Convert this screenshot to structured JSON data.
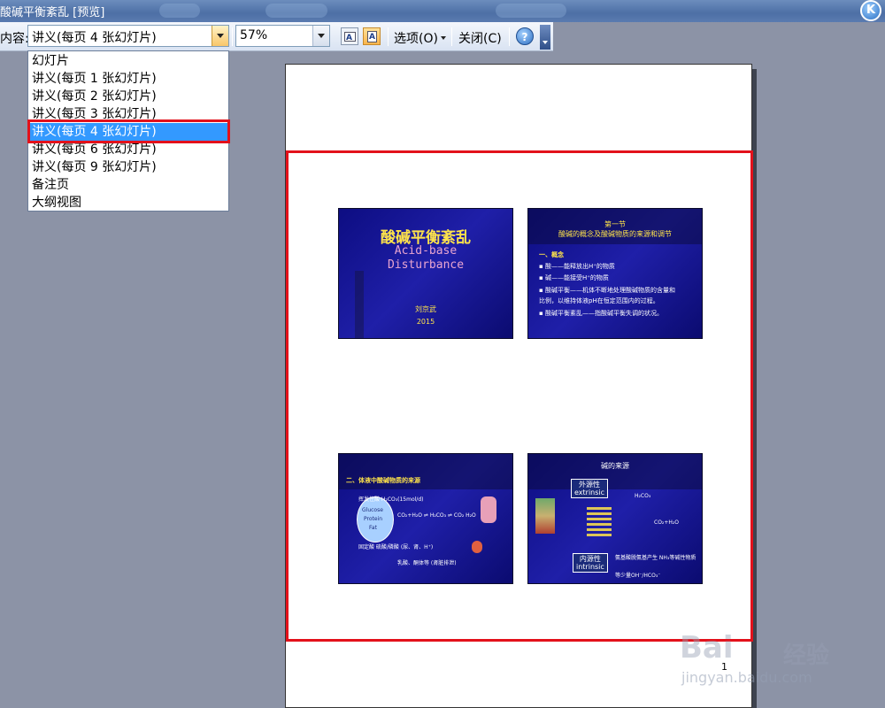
{
  "window": {
    "title": "酸碱平衡紊乱 [预览]"
  },
  "toolbar": {
    "content_label": "内容:",
    "content_value": "讲义(每页 4 张幻灯片)",
    "zoom_value": "57%",
    "options_label": "选项(O)",
    "close_label": "关闭(C)",
    "help_glyph": "?",
    "icons": [
      "landscape-orientation-icon",
      "portrait-orientation-icon",
      "help-icon"
    ]
  },
  "dropdown": {
    "items": [
      "幻灯片",
      "讲义(每页 1 张幻灯片)",
      "讲义(每页 2 张幻灯片)",
      "讲义(每页 3 张幻灯片)",
      "讲义(每页 4 张幻灯片)",
      "讲义(每页 6 张幻灯片)",
      "讲义(每页 9 张幻灯片)",
      "备注页",
      "大纲视图"
    ],
    "selected_index": 4
  },
  "preview": {
    "page_number": "1",
    "slides": {
      "s1": {
        "title_cn": "酸碱平衡紊乱",
        "title_en_1": "Acid-base",
        "title_en_2": "Disturbance",
        "author": "刘京武",
        "year": "2015"
      },
      "s2": {
        "heading1": "第一节",
        "heading2": "酸碱的概念及酸碱物质的来源和调节",
        "sub": "一、概念",
        "l1": "▪ 酸——能释放出H⁺的物质",
        "l2": "▪ 碱——能接受H⁺的物质",
        "l3": "▪ 酸碱平衡——机体不断地处理酸碱物质的含量和",
        "l4": "  比例，以维持体液pH在恒定范围内的过程。",
        "l5": "▪ 酸碱平衡紊乱——指酸碱平衡失调的状况。"
      },
      "s3": {
        "heading": "二、体液中酸碱物质的来源",
        "sugar": "Glucose",
        "protein": "Protein",
        "fat": "Fat",
        "eq1": "挥发性酸 H₂CO₃(15mol/d)",
        "eq2": "CO₂+H₂O ⇌ H₂CO₃ ⇌ CO₂ H₂O",
        "eq3": "固定酸  硫酸/磷酸  (尿、肾、H⁺)",
        "eq4": "乳酸、酮体等 (肾脏排泄)"
      },
      "s4": {
        "heading": "碱的来源",
        "ext_cn": "外源性",
        "ext_en": "extrinsic",
        "int_cn": "内源性",
        "int_en": "intrinsic",
        "formula": "H₂CO₃",
        "result": "CO₂+H₂O",
        "note1": "氨基酸脱氨基产生  NH₃等碱性物质",
        "note2": "等少量OH⁻/HCO₃⁻"
      }
    }
  },
  "watermark": {
    "brand": "Bai",
    "brand2": "经验",
    "url": "jingyan.baidu.com"
  },
  "colors": {
    "selection": "#3399ff",
    "highlight_box": "#e3111b",
    "slide_bg": "#0d0d82",
    "slide_title": "#ffe44a"
  }
}
